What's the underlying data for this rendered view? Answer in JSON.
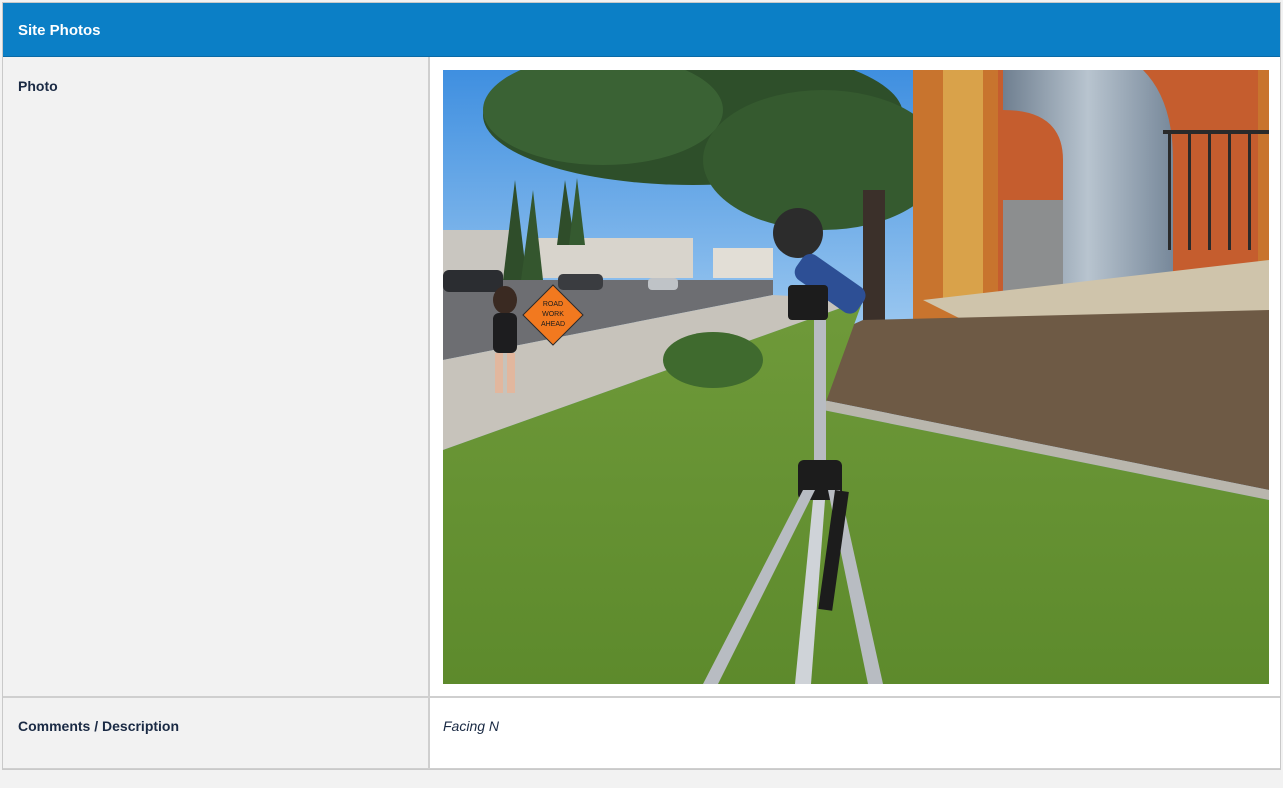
{
  "panel": {
    "title": "Site Photos",
    "header_color": "#0b7fc6"
  },
  "rows": {
    "photo": {
      "label": "Photo",
      "image_icon": "site-photo-image"
    },
    "comments": {
      "label": "Comments / Description",
      "value": "Facing N"
    }
  },
  "sign": {
    "line1": "ROAD",
    "line2": "WORK",
    "line3": "AHEAD"
  }
}
